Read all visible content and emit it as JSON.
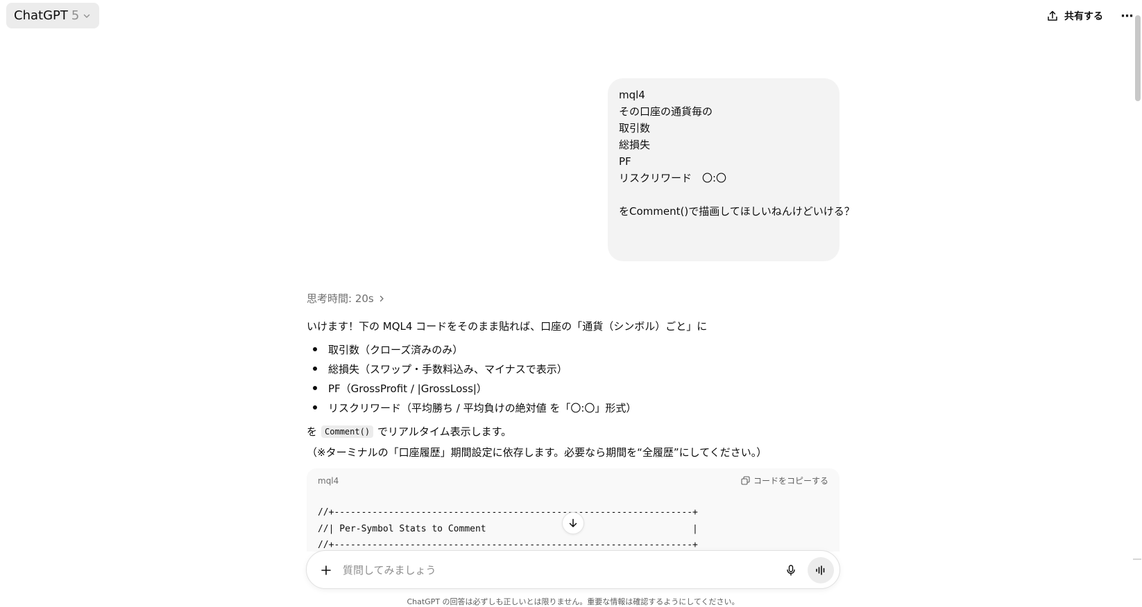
{
  "header": {
    "model_name": "ChatGPT",
    "model_version": "5",
    "share_label": "共有する",
    "more_label": "⋯"
  },
  "user_message": {
    "lines": [
      "mql4",
      "その口座の通貨毎の",
      "取引数",
      "総損失",
      "PF",
      "リスクリワード　〇:〇",
      "",
      "をComment()で描画してほしいねんけどいける？"
    ]
  },
  "assistant": {
    "thought_label": "思考時間: 20s",
    "intro": "いけます！下の MQL4 コードをそのまま貼れば、口座の「通貨（シンボル）ごと」に",
    "bullets": [
      "取引数（クローズ済みのみ）",
      "総損失（スワップ・手数料込み、マイナスで表示）",
      "PF（GrossProfit / |GrossLoss|）",
      "リスクリワード（平均勝ち / 平均負けの絶対値 を「〇:〇」形式）"
    ],
    "after_prefix": "を",
    "inline_code": "Comment()",
    "after_suffix": "でリアルタイム表示します。",
    "note": "（※ターミナルの「口座履歴」期間設定に依存します。必要なら期間を“全履歴”にしてください。）",
    "code_block": {
      "language": "mql4",
      "copy_label": "コードをコピーする",
      "lines": [
        "//+------------------------------------------------------------------+",
        "//| Per-Symbol Stats to Comment                                      |",
        "//+------------------------------------------------------------------+"
      ]
    }
  },
  "composer": {
    "placeholder": "質問してみましょう"
  },
  "disclaimer": "ChatGPT の回答は必ずしも正しいとは限りません。重要な情報は確認するようにしてください。"
}
